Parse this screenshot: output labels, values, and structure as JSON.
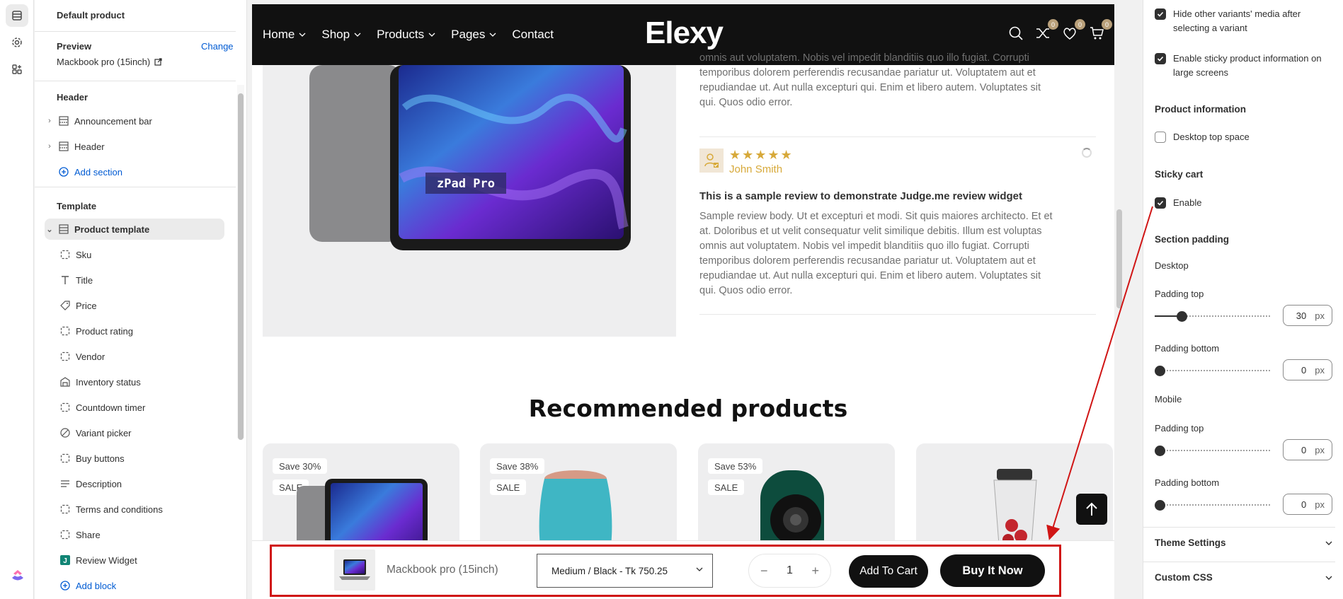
{
  "rail": {
    "icons": [
      "sections-icon",
      "settings-gear-icon",
      "apps-icon"
    ]
  },
  "left_panel": {
    "title": "Default product",
    "preview_label": "Preview",
    "change_label": "Change",
    "preview_product": "Mackbook pro (15inch)",
    "header_section_title": "Header",
    "header_items": [
      "Announcement bar",
      "Header"
    ],
    "add_section": "Add section",
    "template_title": "Template",
    "template_root": "Product template",
    "blocks": [
      "Sku",
      "Title",
      "Price",
      "Product rating",
      "Vendor",
      "Inventory status",
      "Countdown timer",
      "Variant picker",
      "Buy buttons",
      "Description",
      "Terms and conditions",
      "Share",
      "Review Widget"
    ],
    "add_block": "Add block"
  },
  "storefront": {
    "nav_links": [
      "Home",
      "Shop",
      "Products",
      "Pages",
      "Contact"
    ],
    "nav_has_dropdown": [
      true,
      true,
      true,
      true,
      false
    ],
    "brand": "Elexy",
    "badges": {
      "compare": "0",
      "wishlist": "0",
      "cart": "0"
    },
    "media_label": "zPad Pro",
    "review1_text_lines": [
      "omnis aut voluptatem. Nobis vel impedit blanditiis quo illo fugiat. Corrupti",
      "temporibus dolorem perferendis recusandae pariatur ut. Voluptatem aut et",
      "repudiandae ut. Aut nulla excepturi qui. Enim et libero autem. Voluptates sit",
      "qui. Quos odio error."
    ],
    "reviewer_name": "John Smith",
    "rating_stars": 5,
    "review_title": "This is a sample review to demonstrate Judge.me review widget",
    "review2_text_lines": [
      "Sample review body. Ut et excepturi et modi. Sit quis maiores architecto. Et et",
      "at. Doloribus et ut velit consequatur velit similique debitis. Illum est voluptas",
      "omnis aut voluptatem. Nobis vel impedit blanditiis quo illo fugiat. Corrupti",
      "temporibus dolorem perferendis recusandae pariatur ut. Voluptatem aut et",
      "repudiandae ut. Aut nulla excepturi qui. Enim et libero autem. Voluptates sit",
      "qui. Quos odio error."
    ],
    "recommended_title": "Recommended products",
    "cards": [
      {
        "save": "Save 30%",
        "sale": "SALE"
      },
      {
        "save": "Save 38%",
        "sale": "SALE"
      },
      {
        "save": "Save 53%",
        "sale": "SALE"
      },
      {
        "save": "",
        "sale": ""
      }
    ],
    "sticky_cart": {
      "product_name": "Mackbook pro (15inch)",
      "variant": "Medium / Black - Tk 750.25",
      "quantity": "1",
      "minus": "−",
      "plus": "+",
      "add_to_cart": "Add To Cart",
      "buy_now": "Buy It Now"
    }
  },
  "right_panel": {
    "hide_variants_label": "Hide other variants' media after selecting a variant",
    "hide_variants_checked": true,
    "sticky_info_label": "Enable sticky product information on large screens",
    "sticky_info_checked": true,
    "product_info_title": "Product information",
    "desktop_top_space_label": "Desktop top space",
    "desktop_top_space_checked": false,
    "sticky_cart_title": "Sticky cart",
    "sticky_enable_label": "Enable",
    "sticky_enable_checked": true,
    "section_padding_title": "Section padding",
    "desktop_label": "Desktop",
    "mobile_label": "Mobile",
    "padding_top_label": "Padding top",
    "padding_bottom_label": "Padding bottom",
    "unit": "px",
    "desktop_padding_top": "30",
    "desktop_padding_bottom": "0",
    "mobile_padding_top": "0",
    "mobile_padding_bottom": "0",
    "theme_settings": "Theme Settings",
    "custom_css": "Custom CSS"
  },
  "colors": {
    "accent_blue": "#005bd3",
    "highlight_red": "#d01515",
    "star_gold": "#d7a93a",
    "nav_black": "#111111",
    "badge_tan": "#b9a07a"
  }
}
